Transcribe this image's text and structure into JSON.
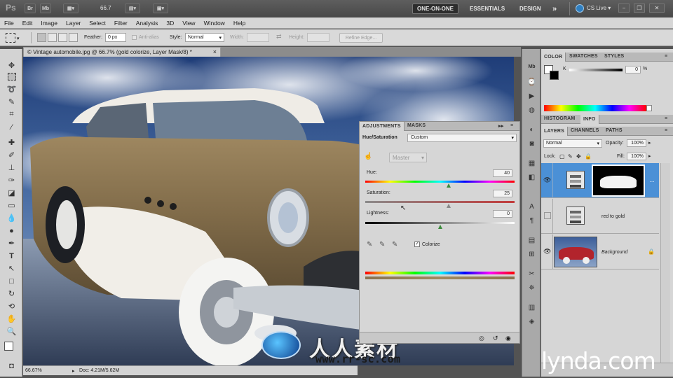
{
  "app_bar": {
    "logo": "Ps",
    "bridge_label": "Br",
    "minibridge_label": "Mb",
    "zoom_display": "66.7",
    "workspaces": [
      "ONE-ON-ONE",
      "ESSENTIALS",
      "DESIGN"
    ],
    "more_workspaces": "»",
    "cs_live": "CS Live"
  },
  "menu": [
    "File",
    "Edit",
    "Image",
    "Layer",
    "Select",
    "Filter",
    "Analysis",
    "3D",
    "View",
    "Window",
    "Help"
  ],
  "options_bar": {
    "feather_label": "Feather:",
    "feather_value": "0 px",
    "antialias_label": "Anti-alias",
    "style_label": "Style:",
    "style_value": "Normal",
    "width_label": "Width:",
    "height_label": "Height:",
    "refine_edge": "Refine Edge..."
  },
  "document": {
    "tab_title": "© Vintage automobile.jpg @ 66.7% (gold colorize, Layer Mask/8) *",
    "close_glyph": "×"
  },
  "status_bar": {
    "zoom": "66.67%",
    "doc_info": "Doc: 4.21M/5.62M"
  },
  "adjustments": {
    "tabs": [
      "ADJUSTMENTS",
      "MASKS"
    ],
    "title": "Hue/Saturation",
    "preset": "Custom",
    "channel": "Master",
    "hue": {
      "label": "Hue:",
      "value": "40",
      "fraction": 0.56
    },
    "saturation": {
      "label": "Saturation:",
      "value": "25",
      "fraction": 0.56
    },
    "lightness": {
      "label": "Lightness:",
      "value": "0",
      "fraction": 0.5
    },
    "colorize_label": "Colorize",
    "colorize_checked": true
  },
  "color_panel": {
    "tabs": [
      "COLOR",
      "SWATCHES",
      "STYLES"
    ],
    "channel_label": "K",
    "channel_value": "0",
    "unit": "%"
  },
  "info_panel": {
    "tabs": [
      "HISTOGRAM",
      "INFO"
    ]
  },
  "layers_panel": {
    "tabs": [
      "LAYERS",
      "CHANNELS",
      "PATHS"
    ],
    "blend_mode": "Normal",
    "opacity_label": "Opacity:",
    "opacity_value": "100%",
    "lock_label": "Lock:",
    "fill_label": "Fill:",
    "fill_value": "100%",
    "layers": [
      {
        "name": "",
        "selected": true,
        "visible": true
      },
      {
        "name": "red to gold",
        "selected": false,
        "visible": false
      },
      {
        "name": "Background",
        "selected": false,
        "visible": true
      }
    ]
  },
  "watermark": {
    "text": "人人素材",
    "url": "www.rr-sc.com",
    "lynda": "lynda.com"
  },
  "colors": {
    "accent_selected": "#4b90d6",
    "car_gold": "#8a7350",
    "sky": "#2f4d7f"
  }
}
